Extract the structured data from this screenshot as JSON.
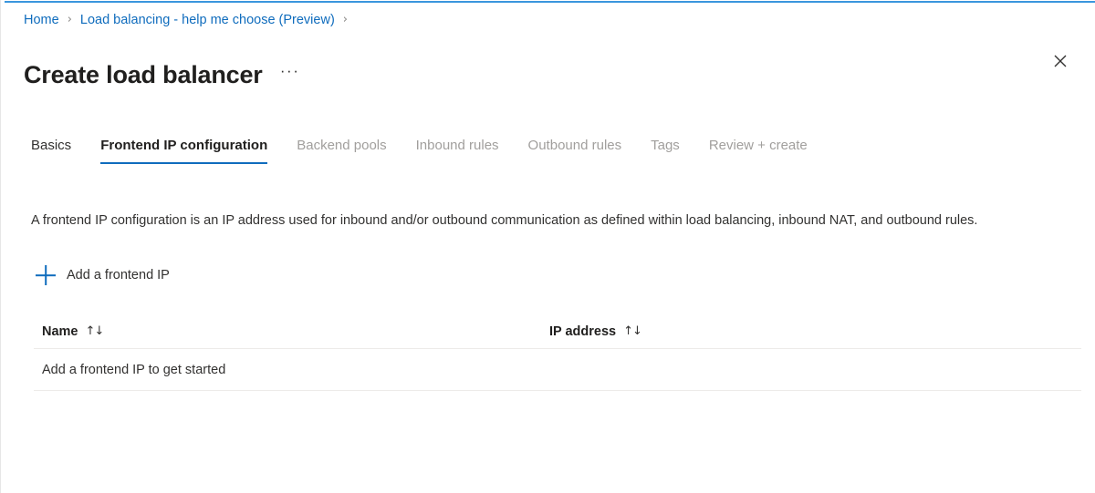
{
  "breadcrumb": {
    "items": [
      {
        "label": "Home",
        "type": "link"
      },
      {
        "label": "Load balancing - help me choose (Preview)",
        "type": "link"
      }
    ],
    "separator": "›",
    "trailing_separator": "›"
  },
  "header": {
    "title": "Create load balancer",
    "more_commands_label": "···",
    "more_commands_name": "more-commands",
    "close_icon": "close-icon"
  },
  "tabs": [
    {
      "label": "Basics",
      "state": "enabled"
    },
    {
      "label": "Frontend IP configuration",
      "state": "active"
    },
    {
      "label": "Backend pools",
      "state": "disabled"
    },
    {
      "label": "Inbound rules",
      "state": "disabled"
    },
    {
      "label": "Outbound rules",
      "state": "disabled"
    },
    {
      "label": "Tags",
      "state": "disabled"
    },
    {
      "label": "Review + create",
      "state": "disabled"
    }
  ],
  "main": {
    "description": "A frontend IP configuration is an IP address used for inbound and/or outbound communication as defined within load balancing, inbound NAT, and outbound rules.",
    "add_command": {
      "label": "Add a frontend IP",
      "icon": "plus-icon"
    },
    "table": {
      "columns": [
        {
          "label": "Name",
          "sort_icon": "↑↓"
        },
        {
          "label": "IP address",
          "sort_icon": "↑↓"
        }
      ],
      "empty_message": "Add a frontend IP to get started",
      "rows": []
    }
  },
  "colors": {
    "accent": "#0f6cbd",
    "top_accent": "#3a96dd",
    "text_primary": "#201f1e",
    "text_secondary": "#323130",
    "text_disabled": "#a19f9d",
    "divider": "#edebe9"
  }
}
